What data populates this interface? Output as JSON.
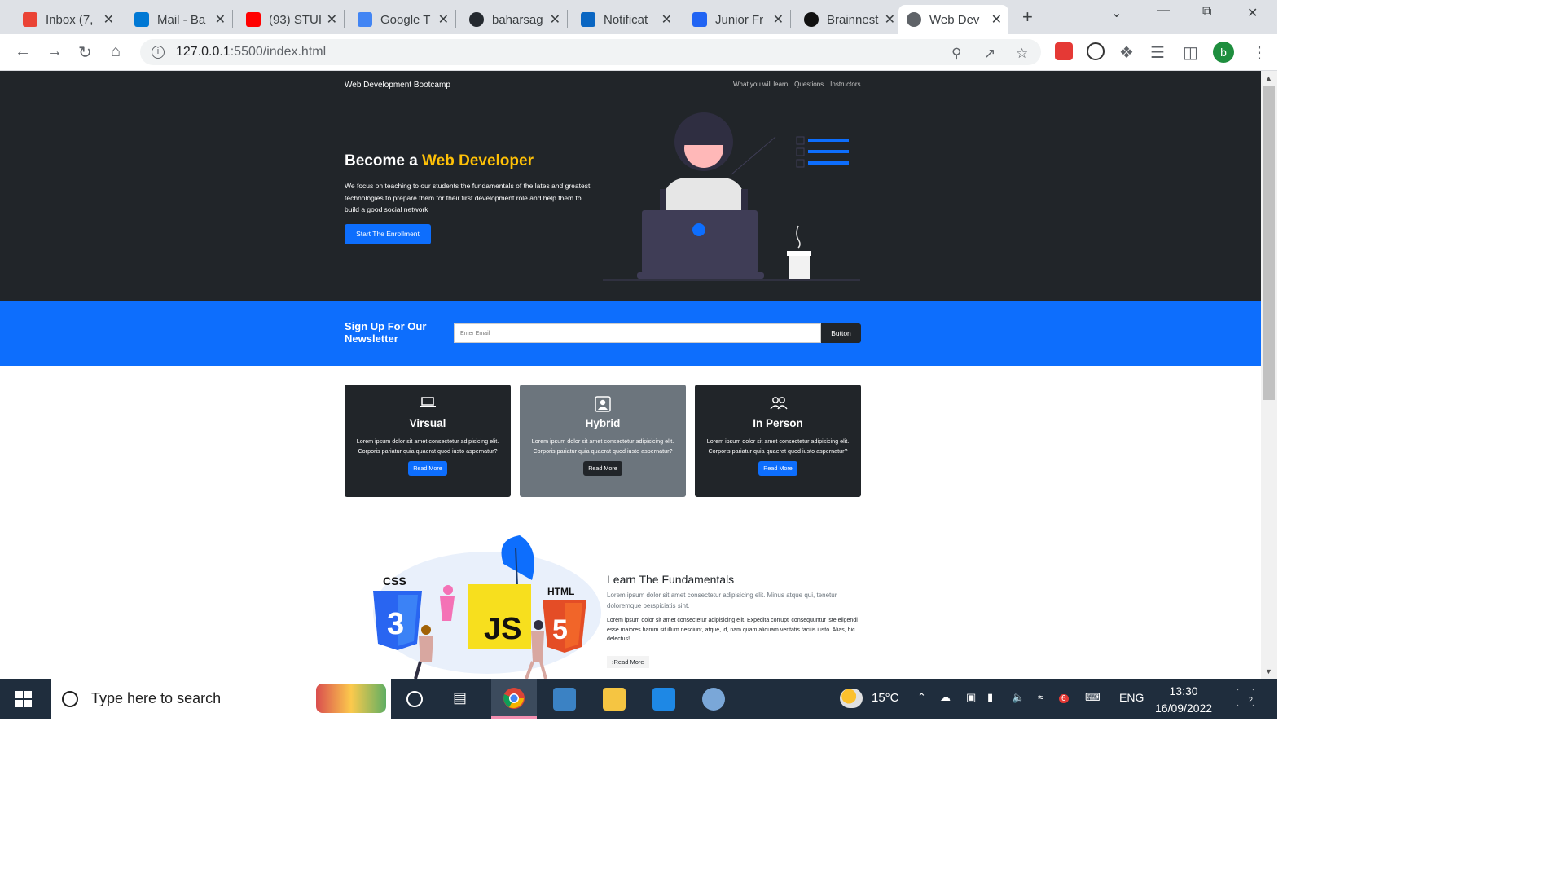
{
  "browser": {
    "tabs": [
      {
        "title": "Inbox (7,",
        "icon": "gmail-icon",
        "color": "#ea4335"
      },
      {
        "title": "Mail - Ba",
        "icon": "outlook-icon",
        "color": "#0078d4"
      },
      {
        "title": "(93) STUI",
        "icon": "youtube-icon",
        "color": "#ff0000"
      },
      {
        "title": "Google T",
        "icon": "google-translate-icon",
        "color": "#4285f4"
      },
      {
        "title": "baharsag",
        "icon": "github-icon",
        "color": "#24292f"
      },
      {
        "title": "Notificat",
        "icon": "linkedin-icon",
        "color": "#0a66c2"
      },
      {
        "title": "Junior Fr",
        "icon": "indeed-icon",
        "color": "#2164f3"
      },
      {
        "title": "Brainnest",
        "icon": "brainnest-icon",
        "color": "#111111"
      },
      {
        "title": "Web Dev",
        "icon": "globe-icon",
        "color": "#5f6368",
        "active": true
      }
    ],
    "url_host": "127.0.0.1",
    "url_rest": ":5500/index.html",
    "profile_initial": "b"
  },
  "site": {
    "brand": "Web Development Bootcamp",
    "nav": [
      "What you will learn",
      "Questions",
      "Instructors"
    ],
    "hero": {
      "title_plain": "Become a ",
      "title_accent": "Web Developer",
      "accent_color": "#ffc107",
      "text": "We focus on teaching to our students the fundamentals of the lates and greatest technologies to prepare them for their first development role and help them to build a good social network",
      "cta": "Start The Enrollment"
    },
    "newsletter": {
      "title": "Sign Up For Our Newsletter",
      "placeholder": "Enter Email",
      "button": "Button"
    },
    "cards": [
      {
        "title": "Virsual",
        "icon": "laptop-icon",
        "text": "Lorem ipsum dolor sit amet consectetur adipisicing elit. Corporis pariatur quia quaerat quod iusto aspernatur?",
        "button": "Read More",
        "bg": "#212529",
        "btn_bg": "#0d6efd"
      },
      {
        "title": "Hybrid",
        "icon": "person-badge-icon",
        "text": "Lorem ipsum dolor sit amet consectetur adipisicing elit. Corporis pariatur quia quaerat quod iusto aspernatur?",
        "button": "Read More",
        "bg": "#6c757d",
        "btn_bg": "#212529"
      },
      {
        "title": "In Person",
        "icon": "people-icon",
        "text": "Lorem ipsum dolor sit amet consectetur adipisicing elit. Corporis pariatur quia quaerat quod iusto aspernatur?",
        "button": "Read More",
        "bg": "#212529",
        "btn_bg": "#0d6efd"
      }
    ],
    "fundamentals": {
      "title": "Learn The Fundamentals",
      "lead": "Lorem ipsum dolor sit amet consectetur adipisicing elit. Minus atque qui, tenetur doloremque perspiciatis sint.",
      "body": "Lorem ipsum dolor sit amet consectetur adipisicing elit. Expedita corrupti consequuntur iste eligendi esse maiores harum sit illum nesciunt, atque, id, nam quam aliquam veritatis facilis iusto. Alias, hic delectus!",
      "button": "Read More",
      "labels": [
        "CSS",
        "JS",
        "HTML"
      ]
    }
  },
  "taskbar": {
    "search_placeholder": "Type here to search",
    "temperature": "15°C",
    "language": "ENG",
    "time": "13:30",
    "date": "16/09/2022",
    "notification_count": "2",
    "update_badge": "6"
  }
}
